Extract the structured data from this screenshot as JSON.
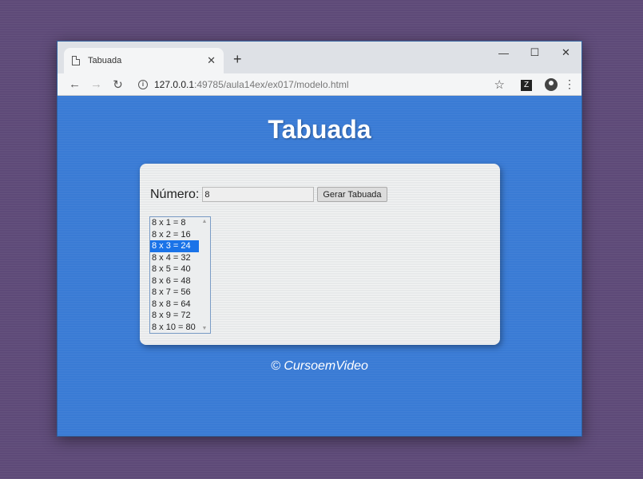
{
  "browser": {
    "tab_title": "Tabuada",
    "tab_close": "✕",
    "new_tab": "+",
    "url_host": "127.0.0.1",
    "url_path": ":49785/aula14ex/ex017/modelo.html",
    "minimize": "—",
    "maximize": "☐",
    "close": "✕",
    "back": "←",
    "forward": "→",
    "reload": "↻",
    "star": "☆",
    "menu": "⋮",
    "info": "i",
    "ext": "Z"
  },
  "page": {
    "title": "Tabuada",
    "number_label": "Número:",
    "number_value": "8",
    "button_label": "Gerar Tabuada",
    "options": [
      "8 x 1 = 8",
      "8 x 2 = 16",
      "8 x 3 = 24",
      "8 x 4 = 32",
      "8 x 5 = 40",
      "8 x 6 = 48",
      "8 x 7 = 56",
      "8 x 8 = 64",
      "8 x 9 = 72",
      "8 x 10 = 80"
    ],
    "selected_index": 2,
    "footer": "© CursoemVideo"
  },
  "colors": {
    "page_bg": "#3a7bd5",
    "selected_bg": "#1a73e8"
  }
}
